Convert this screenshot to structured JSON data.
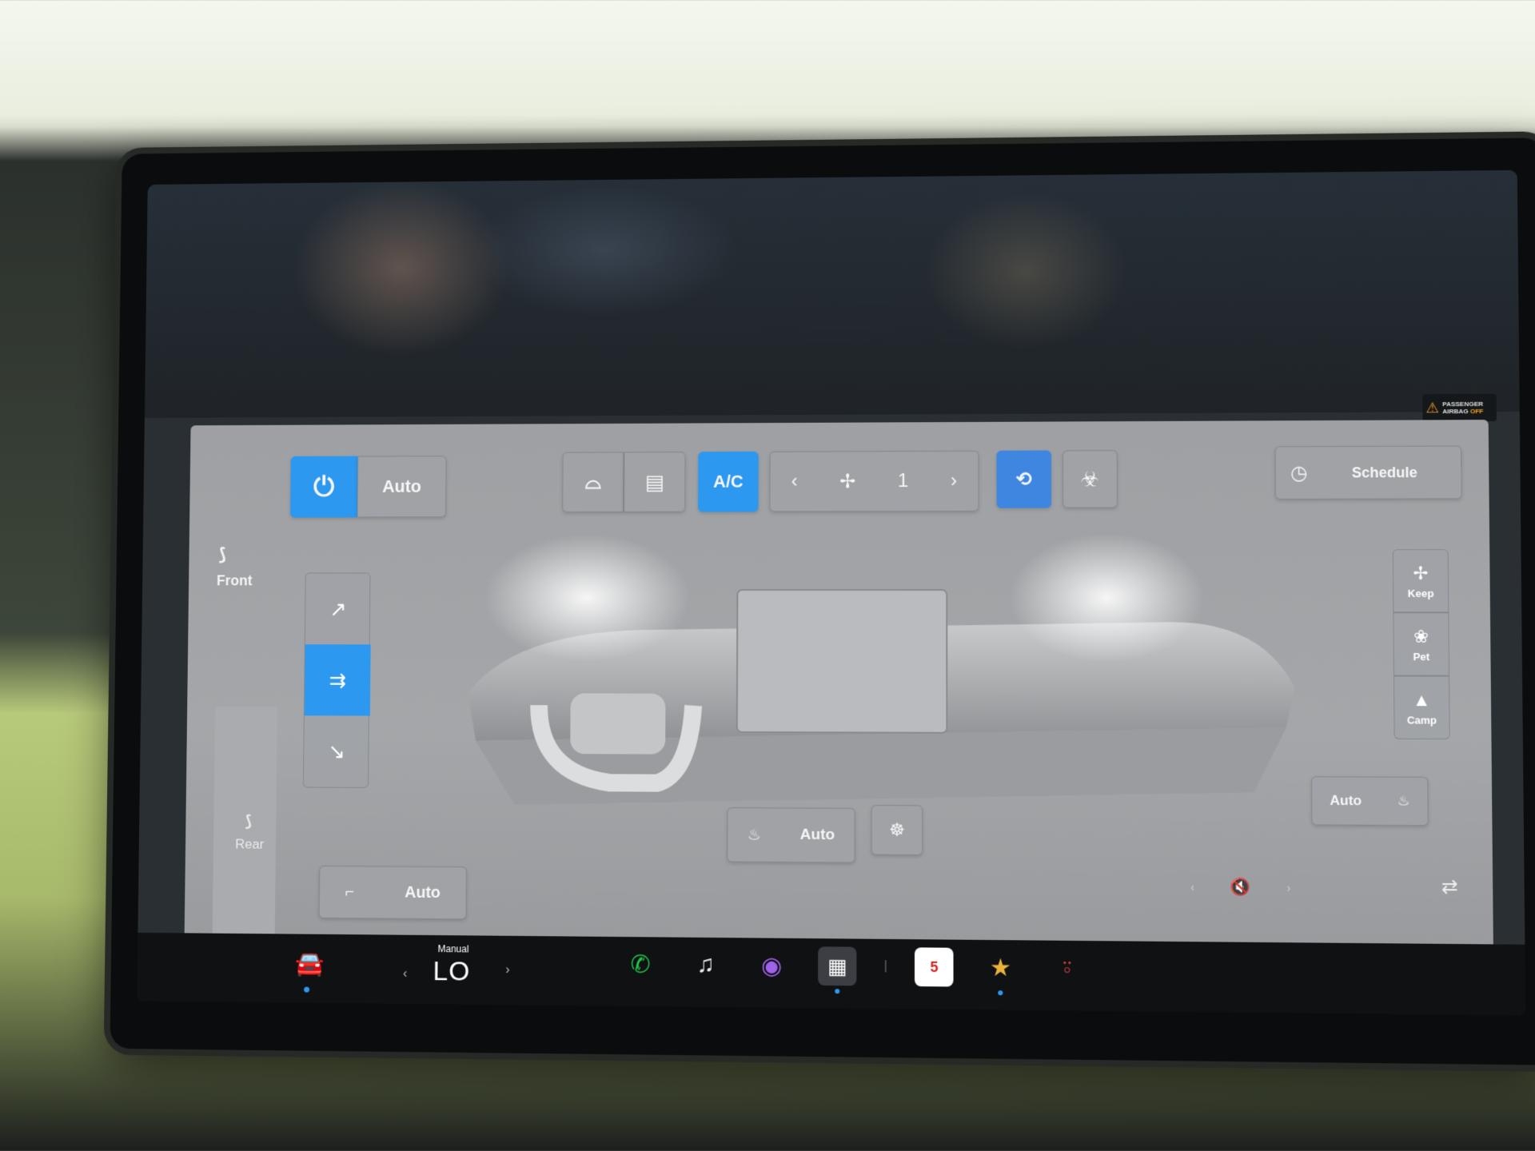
{
  "top_bar": {
    "airbag_line1": "PASSENGER",
    "airbag_line2": "AIRBAG",
    "airbag_state": "OFF"
  },
  "climate": {
    "power_icon": "power-icon",
    "auto_label": "Auto",
    "defrost_front_icon": "front-defrost-icon",
    "defrost_rear_icon": "rear-defrost-icon",
    "ac_label": "A/C",
    "fan_speed": "1",
    "fan_left": "‹",
    "fan_right": "›",
    "recirc_icon": "recirculate-icon",
    "bio_icon": "bioweapon-defense-icon",
    "schedule_label": "Schedule",
    "front_label": "Front",
    "rear_label": "Rear",
    "rear_auto_label": "Auto",
    "keep_label": "Keep",
    "pet_label": "Pet",
    "camp_label": "Camp",
    "passenger_auto_label": "Auto",
    "seat_auto_label": "Auto"
  },
  "taskbar": {
    "temp_mode": "Manual",
    "temp_value": "LO",
    "temp_left": "‹",
    "temp_right": "›",
    "calendar_day": "5"
  },
  "colors": {
    "accent_blue": "#2c98f0",
    "panel_gray": "#a4a6a9"
  }
}
